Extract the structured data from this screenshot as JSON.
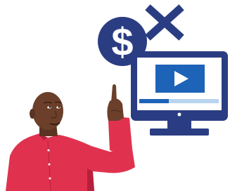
{
  "illustration": {
    "dollar_sign": "$",
    "icon_names": {
      "no_cost": "dollar-x-icon",
      "monitor": "monitor-icon",
      "video": "video-play-icon",
      "person": "pointing-person"
    },
    "colors": {
      "background": "#ffffff",
      "navy": "#2b3d82",
      "video_panel": "#1d63b8",
      "progress_track": "#b8d4f0",
      "progress_fill": "#1d63b8",
      "shirt": "#e0324f",
      "shirt_shadow": "#b81f3b",
      "skin": "#6b3f2a",
      "skin_shadow": "#4e2c1d",
      "buttons": "#ffffff"
    }
  }
}
